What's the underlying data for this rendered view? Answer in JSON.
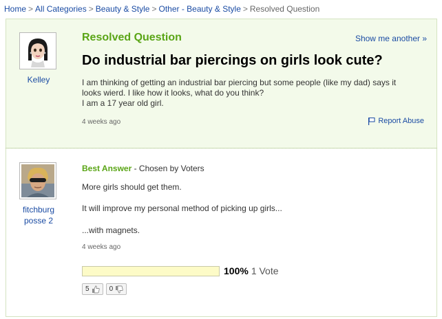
{
  "breadcrumb": {
    "items": [
      "Home",
      "All Categories",
      "Beauty & Style",
      "Other - Beauty & Style"
    ],
    "current": "Resolved Question",
    "separator": ">"
  },
  "question": {
    "status": "Resolved Question",
    "show_another": "Show me another »",
    "title": "Do industrial bar piercings on girls look cute?",
    "body_lines": [
      "I am thinking of getting an industrial bar piercing but some people (like my dad) says it",
      "looks wierd. I like how it looks, what do you think?",
      "I am a 17 year old girl."
    ],
    "time": "4 weeks ago",
    "report_abuse": "Report Abuse",
    "asker": {
      "name": "Kelley",
      "avatar_icon": "cartoon-girl-avatar-icon"
    }
  },
  "answer": {
    "label": "Best Answer",
    "chosen_by": " - Chosen by Voters",
    "lines": [
      "More girls should get them.",
      "It will improve my personal method of picking up girls...",
      "...with magnets."
    ],
    "time": "4 weeks ago",
    "answerer": {
      "name_line1": "fitchburg",
      "name_line2": "posse 2",
      "avatar_icon": "user-photo-avatar-icon"
    },
    "vote": {
      "percent_label": "100%",
      "votes_label": "1 Vote",
      "fill_fraction": 1.0
    },
    "thumbs_up": "5",
    "thumbs_down": "0"
  },
  "colors": {
    "link": "#1a4ba3",
    "accent_green": "#5aa516",
    "panel_bg": "#f3faea",
    "vote_fill": "#fdfbc7"
  }
}
